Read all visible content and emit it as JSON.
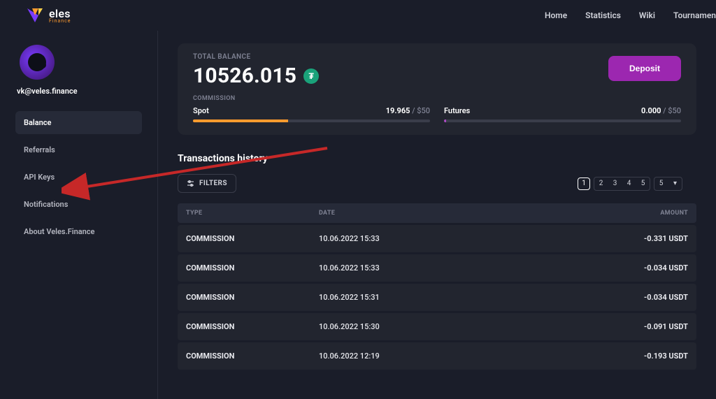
{
  "brand": {
    "name": "eles",
    "sub": "Finance"
  },
  "nav": {
    "home": "Home",
    "stats": "Statistics",
    "wiki": "Wiki",
    "tournament": "Tournamen"
  },
  "user": {
    "email": "vk@veles.finance"
  },
  "sidebar": {
    "items": [
      {
        "label": "Balance"
      },
      {
        "label": "Referrals"
      },
      {
        "label": "API Keys"
      },
      {
        "label": "Notifications"
      },
      {
        "label": "About Veles.Finance"
      }
    ]
  },
  "balance": {
    "label": "TOTAL BALANCE",
    "value": "10526.015",
    "deposit": "Deposit"
  },
  "commission": {
    "label": "COMMISSION",
    "spot": {
      "name": "Spot",
      "value": "19.965",
      "max": "/ $50",
      "pct": 40
    },
    "futures": {
      "name": "Futures",
      "value": "0.000",
      "max": "/ $50",
      "pct": 0
    }
  },
  "transactions": {
    "title": "Transactions history",
    "filters": "FILTERS",
    "pages": [
      "1",
      "2",
      "3",
      "4",
      "5"
    ],
    "more_page": "5",
    "headers": {
      "type": "TYPE",
      "date": "DATE",
      "amount": "AMOUNT"
    },
    "rows": [
      {
        "type": "COMMISSION",
        "date": "10.06.2022 15:33",
        "amount": "-0.331 USDT"
      },
      {
        "type": "COMMISSION",
        "date": "10.06.2022 15:33",
        "amount": "-0.034 USDT"
      },
      {
        "type": "COMMISSION",
        "date": "10.06.2022 15:31",
        "amount": "-0.034 USDT"
      },
      {
        "type": "COMMISSION",
        "date": "10.06.2022 15:30",
        "amount": "-0.091 USDT"
      },
      {
        "type": "COMMISSION",
        "date": "10.06.2022 12:19",
        "amount": "-0.193 USDT"
      }
    ]
  }
}
